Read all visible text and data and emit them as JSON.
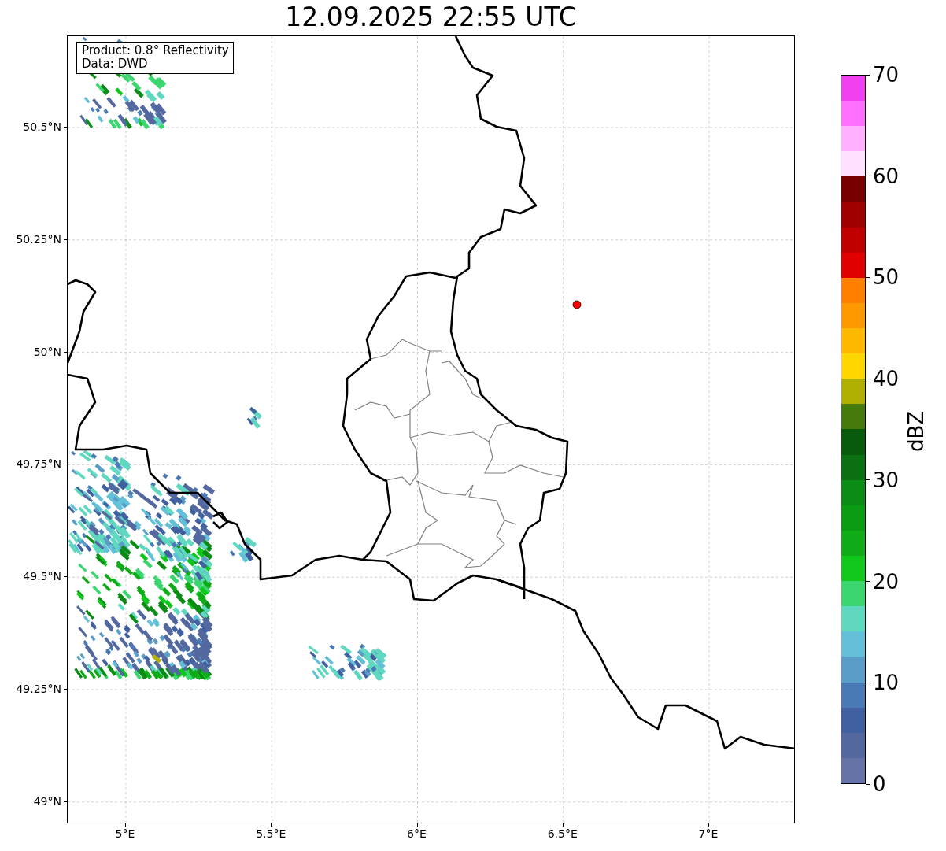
{
  "title": "12.09.2025 22:55 UTC",
  "legend": [
    "Product: 0.8° Reflectivity",
    "Data: DWD"
  ],
  "map": {
    "lat_ticks": [
      "50.5°N",
      "50.25°N",
      "50°N",
      "49.75°N",
      "49.5°N",
      "49.25°N",
      "49°N"
    ],
    "lon_ticks": [
      "5°E",
      "5.5°E",
      "6°E",
      "6.5°E",
      "7°E"
    ]
  },
  "colorbar": {
    "label": "dBZ",
    "ticks": [
      "70",
      "60",
      "50",
      "40",
      "30",
      "20",
      "10",
      "0"
    ],
    "segments": [
      {
        "color": "#6673a6"
      },
      {
        "color": "#5468a0"
      },
      {
        "color": "#4060a0"
      },
      {
        "color": "#4a7ab5"
      },
      {
        "color": "#5a9ec8"
      },
      {
        "color": "#64c0d8"
      },
      {
        "color": "#60d8c0"
      },
      {
        "color": "#3cd670"
      },
      {
        "color": "#10c81c"
      },
      {
        "color": "#10ac18"
      },
      {
        "color": "#0c9c14"
      },
      {
        "color": "#0b8c14"
      },
      {
        "color": "#0b7012"
      },
      {
        "color": "#085a0c"
      },
      {
        "color": "#467a0c"
      },
      {
        "color": "#b0b000"
      },
      {
        "color": "#ffd700"
      },
      {
        "color": "#ffb800"
      },
      {
        "color": "#ff9900"
      },
      {
        "color": "#ff7f00"
      },
      {
        "color": "#e00000"
      },
      {
        "color": "#c00000"
      },
      {
        "color": "#a00000"
      },
      {
        "color": "#780000"
      },
      {
        "color": "#ffe0ff"
      },
      {
        "color": "#ffb0ff"
      },
      {
        "color": "#ff70ff"
      },
      {
        "color": "#f040f0"
      }
    ]
  }
}
